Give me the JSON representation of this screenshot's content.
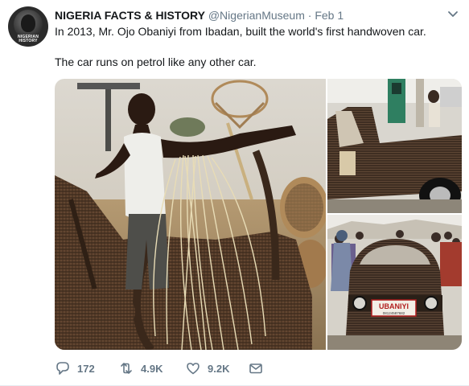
{
  "account": {
    "name": "NIGERIA FACTS & HISTORY",
    "handle": "@NigerianMuseum",
    "separator": "·",
    "date": "Feb 1",
    "avatar_logo_text": "NIGERIAN HISTORY"
  },
  "tweet": {
    "line1": "In 2013, Mr. Ojo Obaniyi from Ibadan, built the world's first handwoven car.",
    "line2": "The car runs on petrol like any other car."
  },
  "media": {
    "plate_text": "UBANIYI",
    "plate_subtext": "08124587682"
  },
  "actions": {
    "replies": "172",
    "retweets": "4.9K",
    "likes": "9.2K"
  },
  "icons": {
    "caret": "chevron-down-icon",
    "reply": "reply-icon",
    "retweet": "retweet-icon",
    "like": "heart-icon",
    "dm": "envelope-icon"
  },
  "colors": {
    "text": "#14171a",
    "secondary": "#657786",
    "divider": "#e6ecf0"
  }
}
